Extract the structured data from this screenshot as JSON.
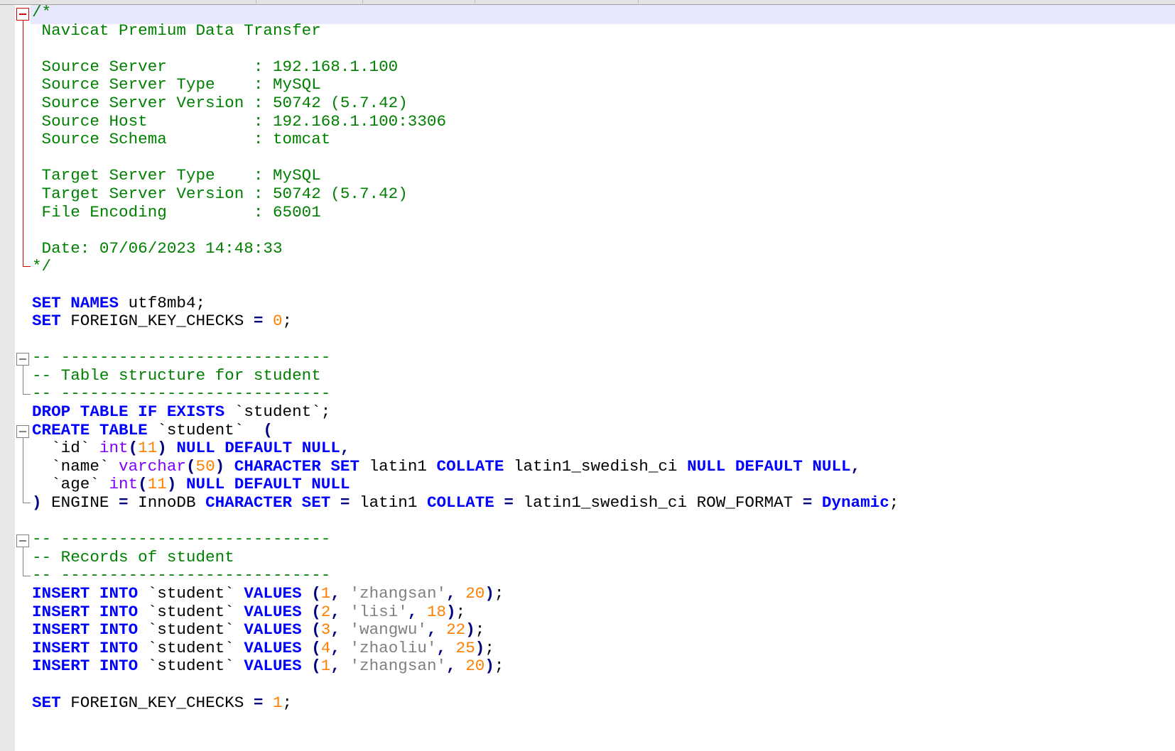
{
  "editor": {
    "language": "sql",
    "colors": {
      "comment": "#008000",
      "keyword": "#0000ff",
      "operator": "#000080",
      "number": "#ff8000",
      "string": "#808080",
      "type": "#8000ff",
      "identifier": "#000000",
      "fold_marker_active": "#d00000",
      "fold_marker": "#808080",
      "current_line": "#e8e8ff"
    },
    "lines": [
      [
        [
          "cm",
          "/*"
        ]
      ],
      [
        [
          "cm",
          " Navicat Premium Data Transfer"
        ]
      ],
      [],
      [
        [
          "cm",
          " Source Server         : 192.168.1.100"
        ]
      ],
      [
        [
          "cm",
          " Source Server Type    : MySQL"
        ]
      ],
      [
        [
          "cm",
          " Source Server Version : 50742 (5.7.42)"
        ]
      ],
      [
        [
          "cm",
          " Source Host           : 192.168.1.100:3306"
        ]
      ],
      [
        [
          "cm",
          " Source Schema         : tomcat"
        ]
      ],
      [],
      [
        [
          "cm",
          " Target Server Type    : MySQL"
        ]
      ],
      [
        [
          "cm",
          " Target Server Version : 50742 (5.7.42)"
        ]
      ],
      [
        [
          "cm",
          " File Encoding         : 65001"
        ]
      ],
      [],
      [
        [
          "cm",
          " Date: 07/06/2023 14:48:33"
        ]
      ],
      [
        [
          "cm",
          "*/"
        ]
      ],
      [],
      [
        [
          "kw",
          "SET"
        ],
        [
          "id",
          " "
        ],
        [
          "kw",
          "NAMES"
        ],
        [
          "id",
          " utf8mb4;"
        ]
      ],
      [
        [
          "kw",
          "SET"
        ],
        [
          "id",
          " FOREIGN_KEY_CHECKS "
        ],
        [
          "op",
          "="
        ],
        [
          "id",
          " "
        ],
        [
          "num",
          "0"
        ],
        [
          "id",
          ";"
        ]
      ],
      [],
      [
        [
          "cm",
          "-- ----------------------------"
        ]
      ],
      [
        [
          "cm",
          "-- Table structure for student"
        ]
      ],
      [
        [
          "cm",
          "-- ----------------------------"
        ]
      ],
      [
        [
          "kw",
          "DROP"
        ],
        [
          "id",
          " "
        ],
        [
          "kw",
          "TABLE"
        ],
        [
          "id",
          " "
        ],
        [
          "kw",
          "IF"
        ],
        [
          "id",
          " "
        ],
        [
          "kw",
          "EXISTS"
        ],
        [
          "id",
          " `student`;"
        ]
      ],
      [
        [
          "kw",
          "CREATE"
        ],
        [
          "id",
          " "
        ],
        [
          "kw",
          "TABLE"
        ],
        [
          "id",
          " `student`  "
        ],
        [
          "op",
          "("
        ]
      ],
      [
        [
          "id",
          "  `id` "
        ],
        [
          "ty",
          "int"
        ],
        [
          "op",
          "("
        ],
        [
          "num",
          "11"
        ],
        [
          "op",
          ")"
        ],
        [
          "id",
          " "
        ],
        [
          "kw",
          "NULL"
        ],
        [
          "id",
          " "
        ],
        [
          "kw",
          "DEFAULT"
        ],
        [
          "id",
          " "
        ],
        [
          "kw",
          "NULL"
        ],
        [
          "op",
          ","
        ]
      ],
      [
        [
          "id",
          "  `name` "
        ],
        [
          "ty",
          "varchar"
        ],
        [
          "op",
          "("
        ],
        [
          "num",
          "50"
        ],
        [
          "op",
          ")"
        ],
        [
          "id",
          " "
        ],
        [
          "kw",
          "CHARACTER"
        ],
        [
          "id",
          " "
        ],
        [
          "kw",
          "SET"
        ],
        [
          "id",
          " latin1 "
        ],
        [
          "kw",
          "COLLATE"
        ],
        [
          "id",
          " latin1_swedish_ci "
        ],
        [
          "kw",
          "NULL"
        ],
        [
          "id",
          " "
        ],
        [
          "kw",
          "DEFAULT"
        ],
        [
          "id",
          " "
        ],
        [
          "kw",
          "NULL"
        ],
        [
          "op",
          ","
        ]
      ],
      [
        [
          "id",
          "  `age` "
        ],
        [
          "ty",
          "int"
        ],
        [
          "op",
          "("
        ],
        [
          "num",
          "11"
        ],
        [
          "op",
          ")"
        ],
        [
          "id",
          " "
        ],
        [
          "kw",
          "NULL"
        ],
        [
          "id",
          " "
        ],
        [
          "kw",
          "DEFAULT"
        ],
        [
          "id",
          " "
        ],
        [
          "kw",
          "NULL"
        ]
      ],
      [
        [
          "op",
          ")"
        ],
        [
          "id",
          " ENGINE "
        ],
        [
          "op",
          "="
        ],
        [
          "id",
          " InnoDB "
        ],
        [
          "kw",
          "CHARACTER"
        ],
        [
          "id",
          " "
        ],
        [
          "kw",
          "SET"
        ],
        [
          "id",
          " "
        ],
        [
          "op",
          "="
        ],
        [
          "id",
          " latin1 "
        ],
        [
          "kw",
          "COLLATE"
        ],
        [
          "id",
          " "
        ],
        [
          "op",
          "="
        ],
        [
          "id",
          " latin1_swedish_ci ROW_FORMAT "
        ],
        [
          "op",
          "="
        ],
        [
          "id",
          " "
        ],
        [
          "kw",
          "Dynamic"
        ],
        [
          "id",
          ";"
        ]
      ],
      [],
      [
        [
          "cm",
          "-- ----------------------------"
        ]
      ],
      [
        [
          "cm",
          "-- Records of student"
        ]
      ],
      [
        [
          "cm",
          "-- ----------------------------"
        ]
      ],
      [
        [
          "kw",
          "INSERT"
        ],
        [
          "id",
          " "
        ],
        [
          "kw",
          "INTO"
        ],
        [
          "id",
          " `student` "
        ],
        [
          "kw",
          "VALUES"
        ],
        [
          "id",
          " "
        ],
        [
          "op",
          "("
        ],
        [
          "num",
          "1"
        ],
        [
          "op",
          ","
        ],
        [
          "id",
          " "
        ],
        [
          "str",
          "'zhangsan'"
        ],
        [
          "op",
          ","
        ],
        [
          "id",
          " "
        ],
        [
          "num",
          "20"
        ],
        [
          "op",
          ")"
        ],
        [
          "id",
          ";"
        ]
      ],
      [
        [
          "kw",
          "INSERT"
        ],
        [
          "id",
          " "
        ],
        [
          "kw",
          "INTO"
        ],
        [
          "id",
          " `student` "
        ],
        [
          "kw",
          "VALUES"
        ],
        [
          "id",
          " "
        ],
        [
          "op",
          "("
        ],
        [
          "num",
          "2"
        ],
        [
          "op",
          ","
        ],
        [
          "id",
          " "
        ],
        [
          "str",
          "'lisi'"
        ],
        [
          "op",
          ","
        ],
        [
          "id",
          " "
        ],
        [
          "num",
          "18"
        ],
        [
          "op",
          ")"
        ],
        [
          "id",
          ";"
        ]
      ],
      [
        [
          "kw",
          "INSERT"
        ],
        [
          "id",
          " "
        ],
        [
          "kw",
          "INTO"
        ],
        [
          "id",
          " `student` "
        ],
        [
          "kw",
          "VALUES"
        ],
        [
          "id",
          " "
        ],
        [
          "op",
          "("
        ],
        [
          "num",
          "3"
        ],
        [
          "op",
          ","
        ],
        [
          "id",
          " "
        ],
        [
          "str",
          "'wangwu'"
        ],
        [
          "op",
          ","
        ],
        [
          "id",
          " "
        ],
        [
          "num",
          "22"
        ],
        [
          "op",
          ")"
        ],
        [
          "id",
          ";"
        ]
      ],
      [
        [
          "kw",
          "INSERT"
        ],
        [
          "id",
          " "
        ],
        [
          "kw",
          "INTO"
        ],
        [
          "id",
          " `student` "
        ],
        [
          "kw",
          "VALUES"
        ],
        [
          "id",
          " "
        ],
        [
          "op",
          "("
        ],
        [
          "num",
          "4"
        ],
        [
          "op",
          ","
        ],
        [
          "id",
          " "
        ],
        [
          "str",
          "'zhaoliu'"
        ],
        [
          "op",
          ","
        ],
        [
          "id",
          " "
        ],
        [
          "num",
          "25"
        ],
        [
          "op",
          ")"
        ],
        [
          "id",
          ";"
        ]
      ],
      [
        [
          "kw",
          "INSERT"
        ],
        [
          "id",
          " "
        ],
        [
          "kw",
          "INTO"
        ],
        [
          "id",
          " `student` "
        ],
        [
          "kw",
          "VALUES"
        ],
        [
          "id",
          " "
        ],
        [
          "op",
          "("
        ],
        [
          "num",
          "1"
        ],
        [
          "op",
          ","
        ],
        [
          "id",
          " "
        ],
        [
          "str",
          "'zhangsan'"
        ],
        [
          "op",
          ","
        ],
        [
          "id",
          " "
        ],
        [
          "num",
          "20"
        ],
        [
          "op",
          ")"
        ],
        [
          "id",
          ";"
        ]
      ],
      [],
      [
        [
          "kw",
          "SET"
        ],
        [
          "id",
          " FOREIGN_KEY_CHECKS "
        ],
        [
          "op",
          "="
        ],
        [
          "id",
          " "
        ],
        [
          "num",
          "1"
        ],
        [
          "id",
          ";"
        ]
      ]
    ]
  }
}
